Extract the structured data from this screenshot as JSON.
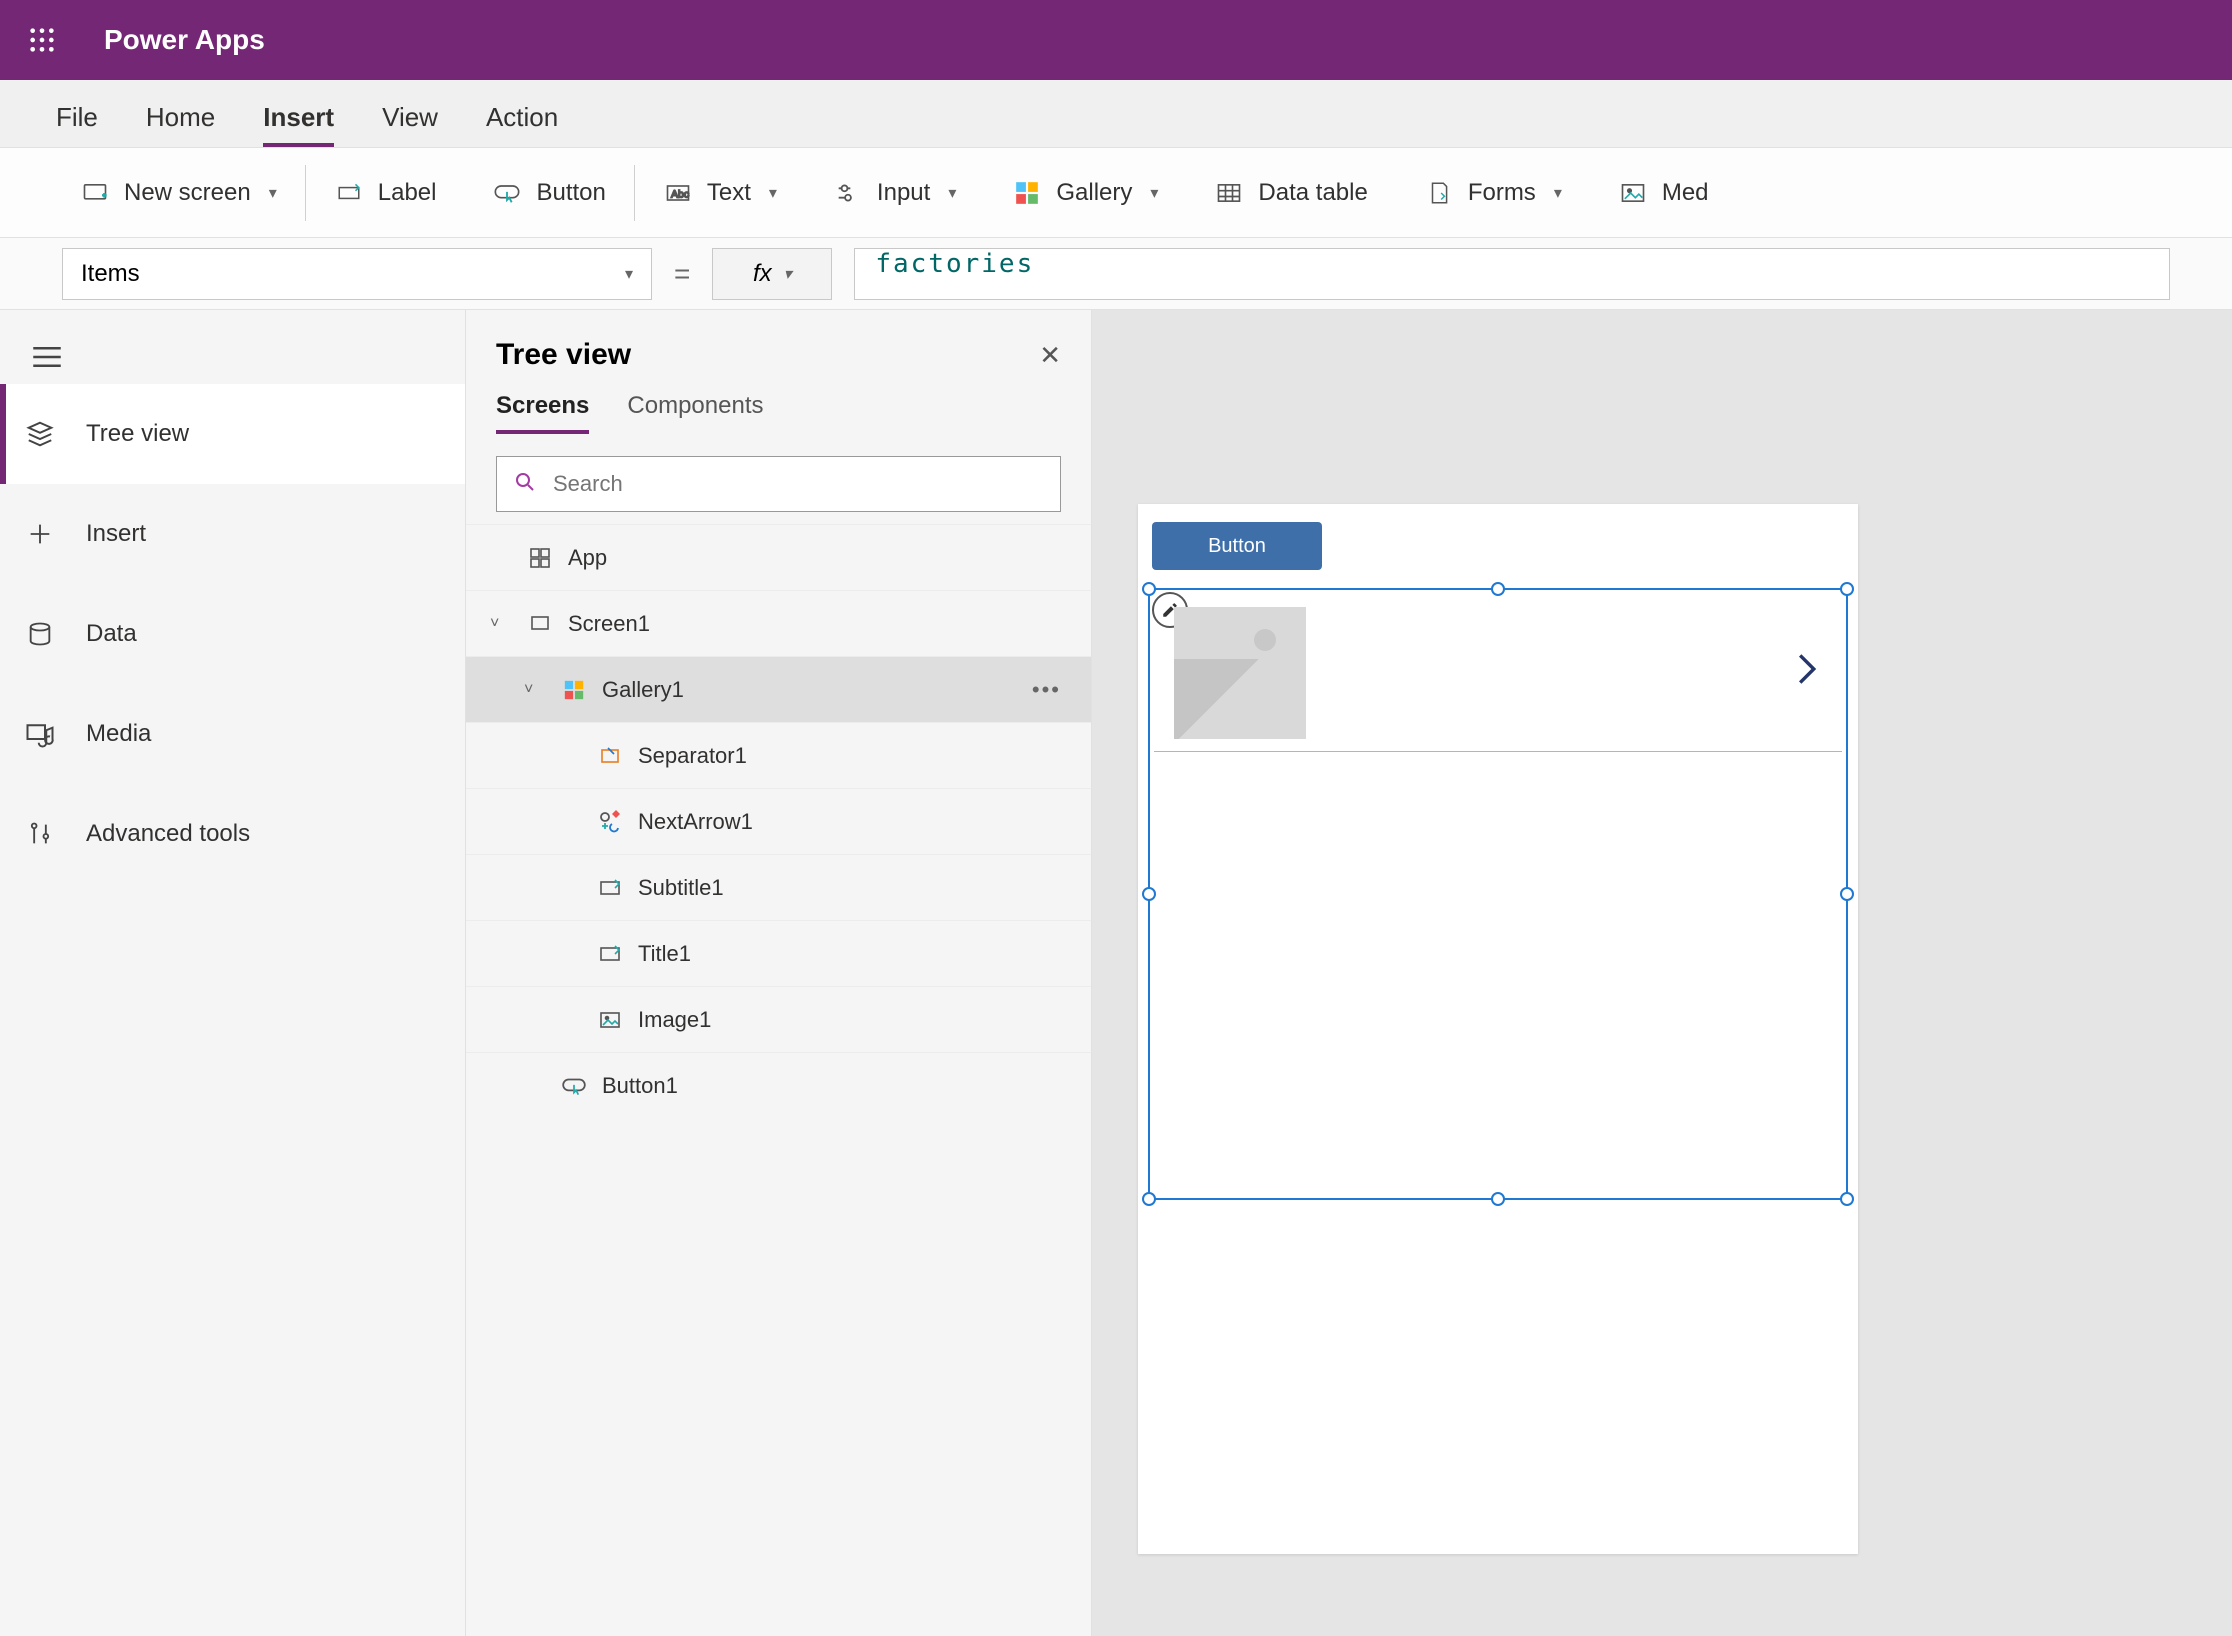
{
  "titlebar": {
    "app_name": "Power Apps"
  },
  "menu": {
    "items": [
      "File",
      "Home",
      "Insert",
      "View",
      "Action"
    ],
    "active": "Insert"
  },
  "ribbon": {
    "new_screen": "New screen",
    "label": "Label",
    "button": "Button",
    "text": "Text",
    "input": "Input",
    "gallery": "Gallery",
    "data_table": "Data table",
    "forms": "Forms",
    "media": "Med"
  },
  "formula": {
    "property": "Items",
    "fx_label": "fx",
    "expression": "factories"
  },
  "rail": {
    "items": [
      {
        "label": "Tree view",
        "icon": "layers"
      },
      {
        "label": "Insert",
        "icon": "plus"
      },
      {
        "label": "Data",
        "icon": "database"
      },
      {
        "label": "Media",
        "icon": "media"
      },
      {
        "label": "Advanced tools",
        "icon": "tools"
      }
    ],
    "active": "Tree view"
  },
  "tree": {
    "title": "Tree view",
    "tabs": [
      "Screens",
      "Components"
    ],
    "active_tab": "Screens",
    "search_placeholder": "Search",
    "nodes": {
      "app": "App",
      "screen1": "Screen1",
      "gallery1": "Gallery1",
      "separator1": "Separator1",
      "nextarrow1": "NextArrow1",
      "subtitle1": "Subtitle1",
      "title1": "Title1",
      "image1": "Image1",
      "button1": "Button1"
    },
    "selected": "Gallery1"
  },
  "canvas": {
    "button_label": "Button"
  }
}
